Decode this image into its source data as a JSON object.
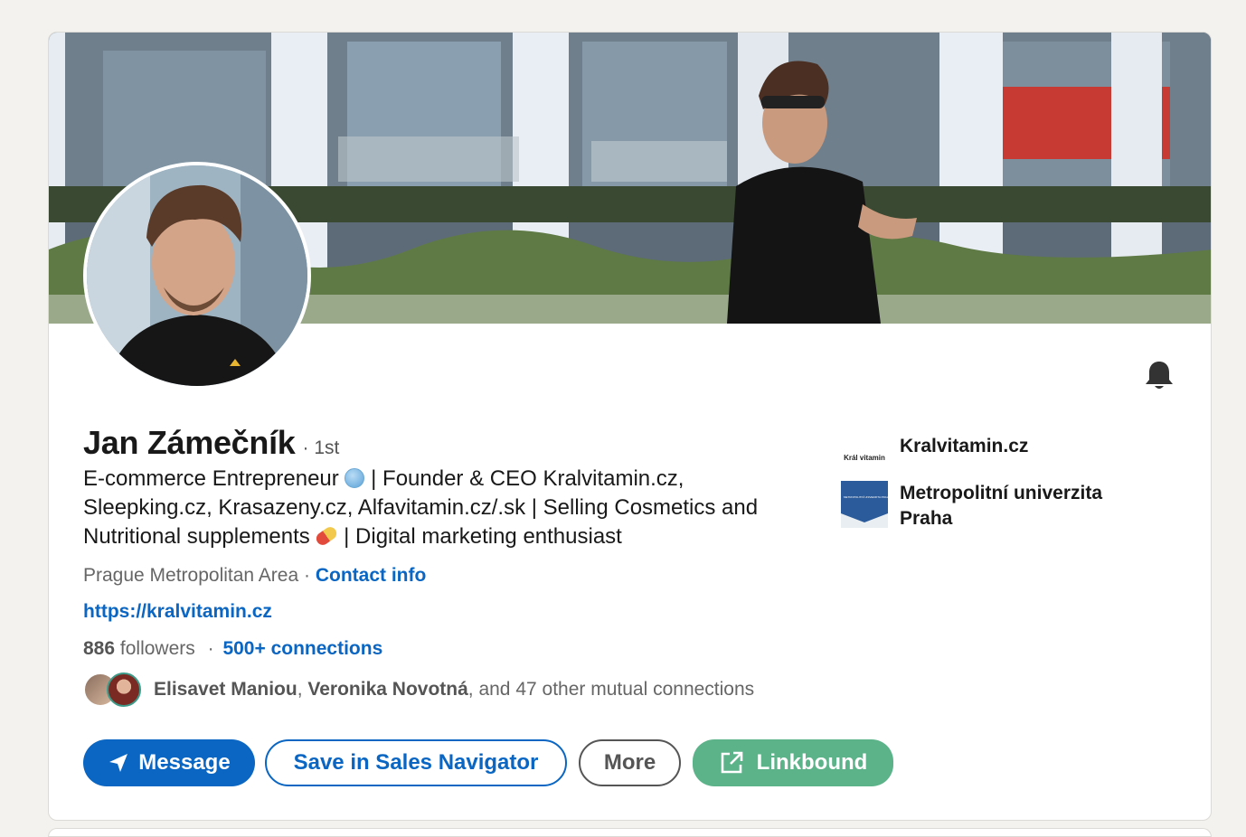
{
  "profile": {
    "name": "Jan Zámečník",
    "degree": "· 1st",
    "headline_1": "E-commerce Entrepreneur",
    "headline_2": "| Founder & CEO Kralvitamin.cz, Sleepking.cz, Krasazeny.cz, Alfavitamin.cz/.sk | Selling Cosmetics and Nutritional supplements",
    "headline_3": "| Digital marketing enthusiast",
    "location": "Prague Metropolitan Area",
    "separator": " · ",
    "contact_info": "Contact info",
    "website": "https://kralvitamin.cz",
    "followers_count": "886",
    "followers_label": "followers",
    "stats_separator": "·",
    "connections": "500+ connections",
    "mutual_1": "Elisavet Maniou",
    "mutual_comma": ", ",
    "mutual_2": "Veronika Novotná",
    "mutual_rest": ", and 47 other mutual connections"
  },
  "organizations": [
    {
      "name": "Kralvitamin.cz",
      "logo_text": "Král vitamin"
    },
    {
      "name": "Metropolitní univerzita Praha",
      "logo_text": "METROPOLITNÍ UNIVERZITA PRAHA"
    }
  ],
  "actions": {
    "message": "Message",
    "sales_navigator": "Save in Sales Navigator",
    "more": "More",
    "linkbound": "Linkbound"
  },
  "icons": {
    "bell": "bell-icon",
    "message": "paper-plane-icon",
    "linkbound": "external-link-icon",
    "globe": "globe-emoji",
    "pill": "pill-emoji"
  },
  "colors": {
    "brand_blue": "#0a66c2",
    "linkbound_green": "#5cb38a",
    "background": "#f4f2ee"
  }
}
